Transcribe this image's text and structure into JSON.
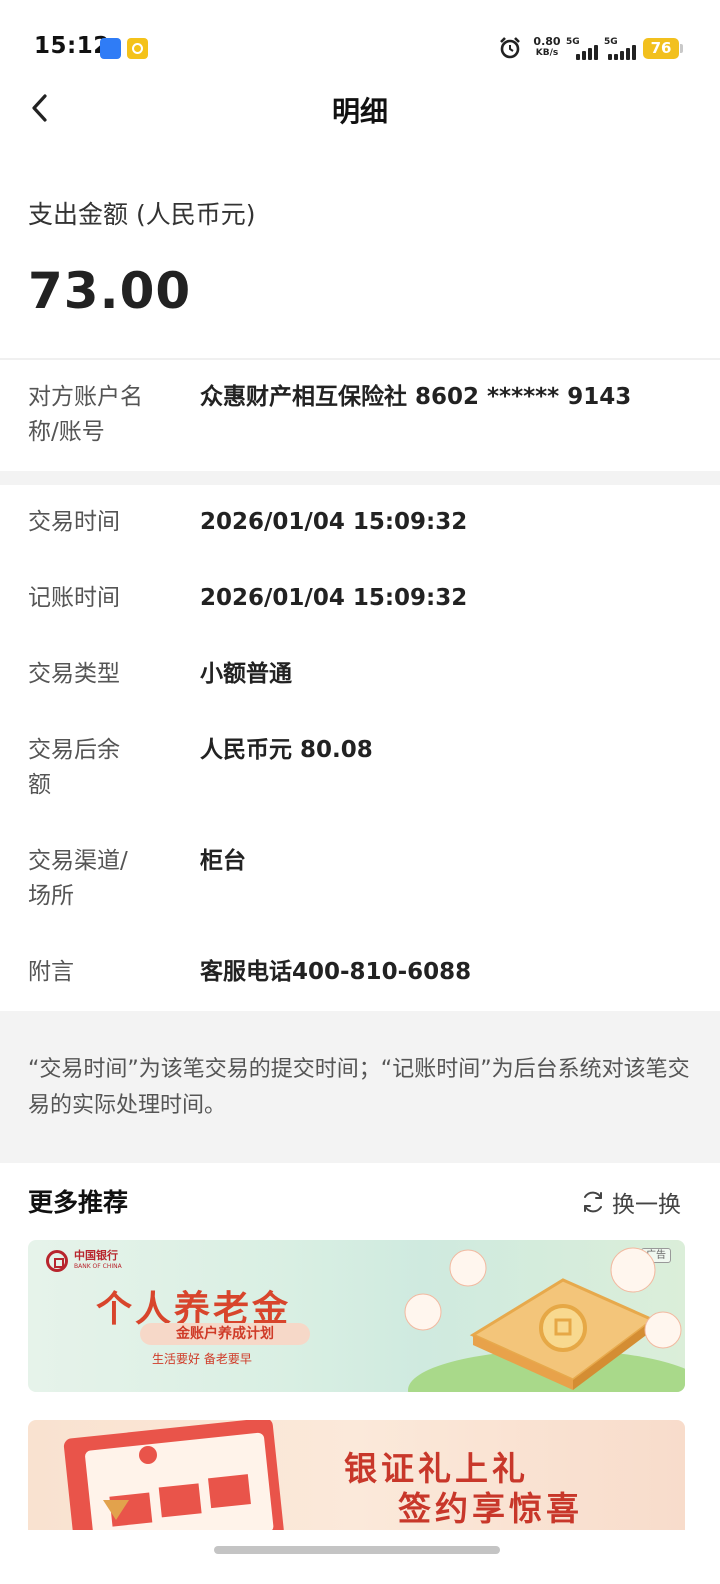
{
  "status_bar": {
    "time": "15:12",
    "net_speed_value": "0.80",
    "net_speed_unit": "KB/s",
    "signal1_label": "5G",
    "signal2_label": "5G",
    "battery": "76",
    "accent_battery": "#f2c01e"
  },
  "header": {
    "title": "明细",
    "back_icon": "chevron-left-icon"
  },
  "amount": {
    "label": "支出金额 (人民币元)",
    "value": "73.00"
  },
  "counterparty": {
    "label": "对方账户名称/账号",
    "value": "众惠财产相互保险社 8602 ****** 9143"
  },
  "details": [
    {
      "label": "交易时间",
      "value": "2026/01/04 15:09:32"
    },
    {
      "label": "记账时间",
      "value": "2026/01/04 15:09:32"
    },
    {
      "label": "交易类型",
      "value": "小额普通"
    },
    {
      "label": "交易后余额",
      "value": "人民币元 80.08"
    },
    {
      "label": "交易渠道/场所",
      "value": "柜台"
    },
    {
      "label": "附言",
      "value": "客服电话400-810-6088"
    }
  ],
  "note": "“交易时间”为该笔交易的提交时间；“记账时间”为后台系统对该笔交易的实际处理时间。",
  "more": {
    "title": "更多推荐",
    "refresh_label": "换一换"
  },
  "banner1": {
    "logo_text": "中国银行",
    "logo_sub": "BANK OF CHINA",
    "title": "个人养老金",
    "subtitle": "金账户养成计划",
    "slogan": "生活要好 备老要早",
    "ad": "广告",
    "color": "#d8452c"
  },
  "banner2": {
    "line1": "银证礼上礼",
    "line2": "签约享惊喜",
    "color": "#c8372a"
  }
}
